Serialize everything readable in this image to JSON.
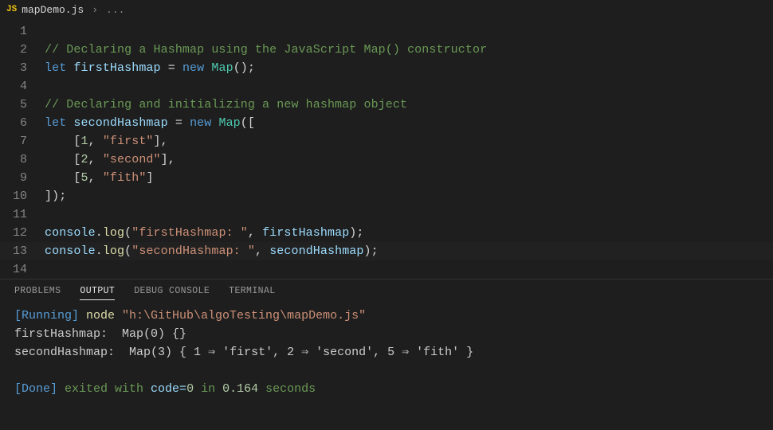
{
  "tab": {
    "badge": "JS",
    "filename": "mapDemo.js",
    "chevron": "›",
    "dots": "..."
  },
  "lines": {
    "l1": "",
    "l2_comment": "// Declaring a Hashmap using the JavaScript Map() constructor",
    "l3_let": "let",
    "l3_var": "firstHashmap",
    "l3_eq": " = ",
    "l3_new": "new",
    "l3_map": "Map",
    "l3_end": "();",
    "l5_comment": "// Declaring and initializing a new hashmap object",
    "l6_let": "let",
    "l6_var": "secondHashmap",
    "l6_eq": " = ",
    "l6_new": "new",
    "l6_map": "Map",
    "l6_open": "([",
    "l7_a": "[",
    "l7_n": "1",
    "l7_c": ", ",
    "l7_s": "\"first\"",
    "l7_b": "],",
    "l8_a": "[",
    "l8_n": "2",
    "l8_c": ", ",
    "l8_s": "\"second\"",
    "l8_b": "],",
    "l9_a": "[",
    "l9_n": "5",
    "l9_c": ", ",
    "l9_s": "\"fith\"",
    "l9_b": "]",
    "l10": "]);",
    "l12_cons": "console",
    "l12_dot": ".",
    "l12_log": "log",
    "l12_open": "(",
    "l12_s": "\"firstHashmap: \"",
    "l12_c": ", ",
    "l12_v": "firstHashmap",
    "l12_close": ");",
    "l13_cons": "console",
    "l13_dot": ".",
    "l13_log": "log",
    "l13_open": "(",
    "l13_s": "\"secondHashmap: \"",
    "l13_c": ", ",
    "l13_v": "secondHashmap",
    "l13_close": ");",
    "gutter": [
      "1",
      "2",
      "3",
      "4",
      "5",
      "6",
      "7",
      "8",
      "9",
      "10",
      "11",
      "12",
      "13",
      "14"
    ]
  },
  "panel": {
    "tabs": {
      "problems": "PROBLEMS",
      "output": "OUTPUT",
      "debug": "DEBUG CONSOLE",
      "terminal": "TERMINAL"
    },
    "run_open": "[Running]",
    "run_rest": " node ",
    "run_path": "\"h:\\GitHub\\algoTesting\\mapDemo.js\"",
    "o1": "firstHashmap:  Map(0) {}",
    "o2": "secondHashmap:  Map(3) { 1 ⇒ 'first', 2 ⇒ 'second', 5 ⇒ 'fith' }",
    "done_open": "[Done]",
    "done_a": " exited with ",
    "done_code": "code=",
    "done_zero": "0",
    "done_b": " in ",
    "done_t": "0.164",
    "done_c": " seconds"
  }
}
